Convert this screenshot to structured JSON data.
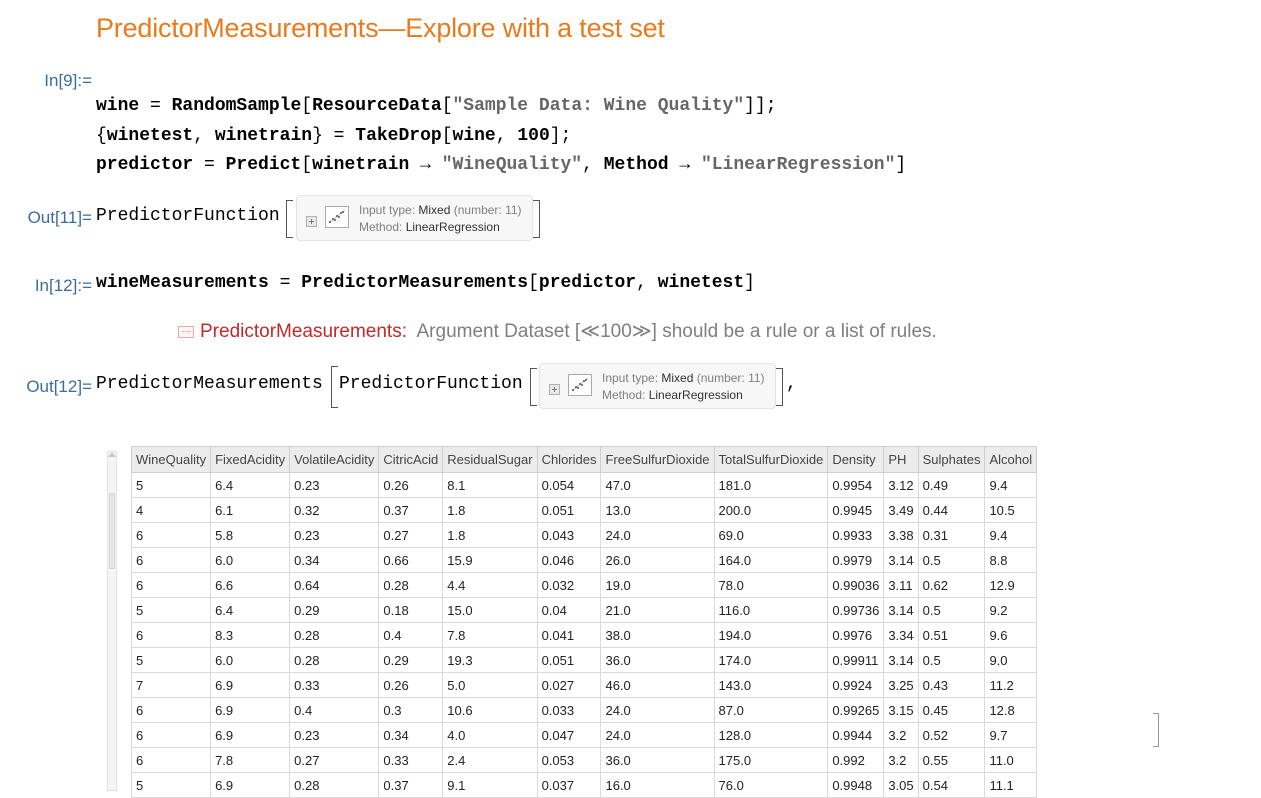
{
  "title": "PredictorMeasurements—Explore with a test set",
  "cells": {
    "in9_label": "In[9]:=",
    "in9_line1": {
      "a": "wine",
      "b": " = ",
      "c": "RandomSample",
      "d": "[",
      "e": "ResourceData",
      "f": "[",
      "g": "\"Sample Data: Wine Quality\"",
      "h": "]];"
    },
    "in9_line2": {
      "a": "{",
      "b": "winetest",
      "c": ", ",
      "d": "winetrain",
      "e": "} = ",
      "f": "TakeDrop",
      "g": "[",
      "h": "wine",
      "i": ", ",
      "j": "100",
      "k": "];"
    },
    "in9_line3": {
      "a": "predictor",
      "b": " = ",
      "c": "Predict",
      "d": "[",
      "e": "winetrain",
      "f": " → ",
      "g": "\"WineQuality\"",
      "h": ", ",
      "i": "Method",
      "j": " → ",
      "k": "\"LinearRegression\"",
      "l": "]"
    },
    "out11_label": "Out[11]=",
    "out11_head": "PredictorFunction",
    "in12_label": "In[12]:=",
    "in12_line": {
      "a": "wineMeasurements",
      "b": " = ",
      "c": "PredictorMeasurements",
      "d": "[",
      "e": "predictor",
      "f": ", ",
      "g": "winetest",
      "h": "]"
    },
    "out12_label": "Out[12]=",
    "out12_head": "PredictorMeasurements",
    "out12_inner": "PredictorFunction",
    "out12_comma": ","
  },
  "summary_box": {
    "input_type_label": "Input type: ",
    "input_type_value": "Mixed",
    "number_note": "(number: 11)",
    "method_label": "Method: ",
    "method_value": "LinearRegression"
  },
  "message": {
    "icon": "⋯",
    "head": "PredictorMeasurements",
    "colon": ":",
    "body": "Argument Dataset [≪100≫] should be a rule or a list of rules."
  },
  "table": {
    "columns": [
      "WineQuality",
      "FixedAcidity",
      "VolatileAcidity",
      "CitricAcid",
      "ResidualSugar",
      "Chlorides",
      "FreeSulfurDioxide",
      "TotalSulfurDioxide",
      "Density",
      "PH",
      "Sulphates",
      "Alcohol"
    ],
    "rows": [
      [
        "5",
        "6.4",
        "0.23",
        "0.26",
        "8.1",
        "0.054",
        "47.0",
        "181.0",
        "0.9954",
        "3.12",
        "0.49",
        "9.4"
      ],
      [
        "4",
        "6.1",
        "0.32",
        "0.37",
        "1.8",
        "0.051",
        "13.0",
        "200.0",
        "0.9945",
        "3.49",
        "0.44",
        "10.5"
      ],
      [
        "6",
        "5.8",
        "0.23",
        "0.27",
        "1.8",
        "0.043",
        "24.0",
        "69.0",
        "0.9933",
        "3.38",
        "0.31",
        "9.4"
      ],
      [
        "6",
        "6.0",
        "0.34",
        "0.66",
        "15.9",
        "0.046",
        "26.0",
        "164.0",
        "0.9979",
        "3.14",
        "0.5",
        "8.8"
      ],
      [
        "6",
        "6.6",
        "0.64",
        "0.28",
        "4.4",
        "0.032",
        "19.0",
        "78.0",
        "0.99036",
        "3.11",
        "0.62",
        "12.9"
      ],
      [
        "5",
        "6.4",
        "0.29",
        "0.18",
        "15.0",
        "0.04",
        "21.0",
        "116.0",
        "0.99736",
        "3.14",
        "0.5",
        "9.2"
      ],
      [
        "6",
        "8.3",
        "0.28",
        "0.4",
        "7.8",
        "0.041",
        "38.0",
        "194.0",
        "0.9976",
        "3.34",
        "0.51",
        "9.6"
      ],
      [
        "5",
        "6.0",
        "0.28",
        "0.29",
        "19.3",
        "0.051",
        "36.0",
        "174.0",
        "0.99911",
        "3.14",
        "0.5",
        "9.0"
      ],
      [
        "7",
        "6.9",
        "0.33",
        "0.26",
        "5.0",
        "0.027",
        "46.0",
        "143.0",
        "0.9924",
        "3.25",
        "0.43",
        "11.2"
      ],
      [
        "6",
        "6.9",
        "0.4",
        "0.3",
        "10.6",
        "0.033",
        "24.0",
        "87.0",
        "0.99265",
        "3.15",
        "0.45",
        "12.8"
      ],
      [
        "6",
        "6.9",
        "0.23",
        "0.34",
        "4.0",
        "0.047",
        "24.0",
        "128.0",
        "0.9944",
        "3.2",
        "0.52",
        "9.7"
      ],
      [
        "6",
        "7.8",
        "0.27",
        "0.33",
        "2.4",
        "0.053",
        "36.0",
        "175.0",
        "0.992",
        "3.2",
        "0.55",
        "11.0"
      ],
      [
        "5",
        "6.9",
        "0.28",
        "0.37",
        "9.1",
        "0.037",
        "16.0",
        "76.0",
        "0.9948",
        "3.05",
        "0.54",
        "11.1"
      ]
    ]
  }
}
